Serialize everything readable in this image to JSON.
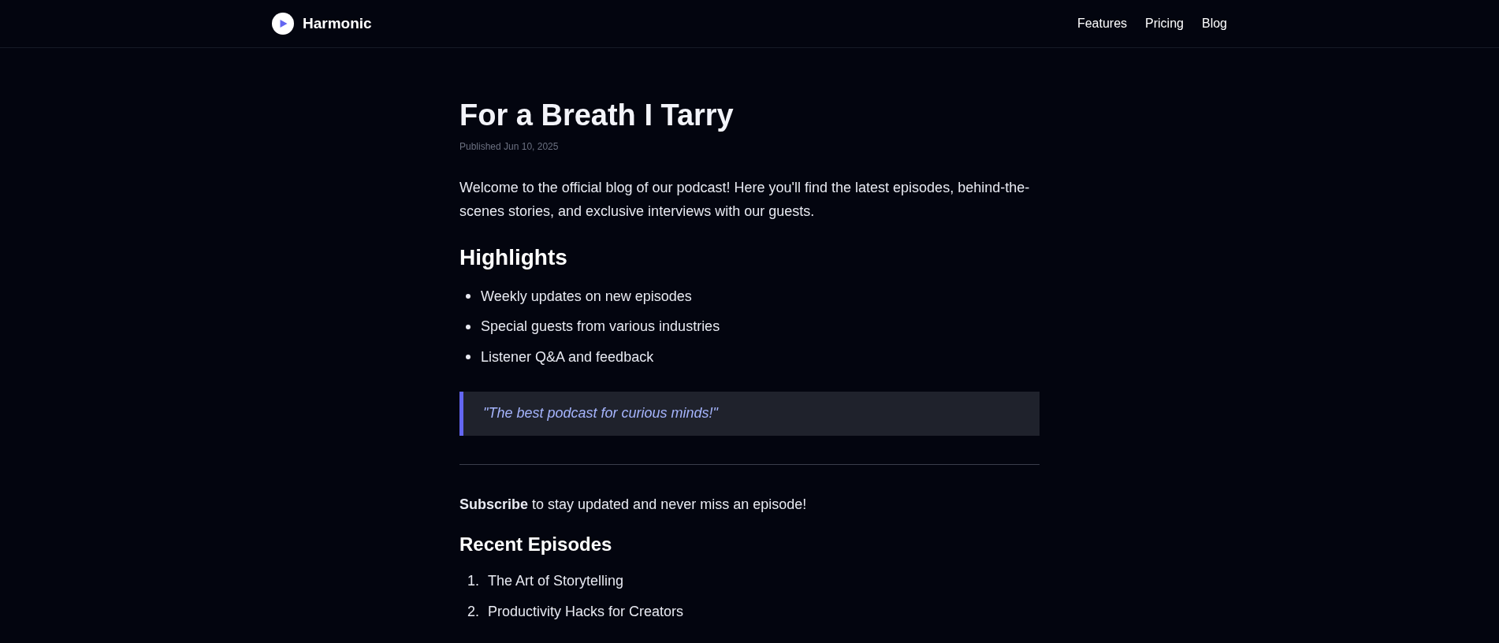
{
  "header": {
    "brand": "Harmonic",
    "nav": [
      {
        "label": "Features"
      },
      {
        "label": "Pricing"
      },
      {
        "label": "Blog"
      }
    ]
  },
  "article": {
    "title": "For a Breath I Tarry",
    "published": "Published Jun 10, 2025",
    "intro": "Welcome to the official blog of our podcast! Here you'll find the latest episodes, behind-the-scenes stories, and exclusive interviews with our guests.",
    "highlights": {
      "heading": "Highlights",
      "items": [
        "Weekly updates on new episodes",
        "Special guests from various industries",
        "Listener Q&A and feedback"
      ]
    },
    "quote": "\"The best podcast for curious minds!\"",
    "subscribe": "**Subscribe** to stay updated and never miss an episode!",
    "recent": {
      "heading": "Recent Episodes",
      "items": [
        {
          "number": "1.",
          "title": "The Art of Storytelling"
        },
        {
          "number": "2.",
          "title": "Productivity Hacks for Creators"
        }
      ]
    }
  }
}
